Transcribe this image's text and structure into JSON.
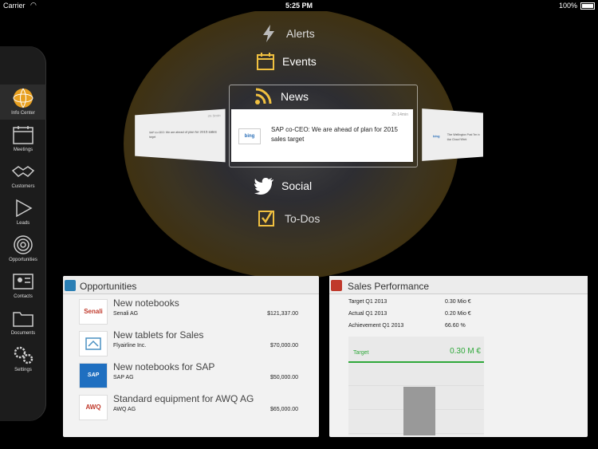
{
  "status_bar": {
    "carrier": "Carrier",
    "time": "5:25 PM",
    "battery": "100%"
  },
  "sidebar": {
    "items": [
      {
        "label": "Info Center",
        "icon": "globe-icon",
        "active": true
      },
      {
        "label": "Meetings",
        "icon": "calendar-icon"
      },
      {
        "label": "Customers",
        "icon": "handshake-icon"
      },
      {
        "label": "Leads",
        "icon": "arrow-icon"
      },
      {
        "label": "Opportunities",
        "icon": "target-icon"
      },
      {
        "label": "Contacts",
        "icon": "contacts-icon"
      },
      {
        "label": "Documents",
        "icon": "folder-icon"
      },
      {
        "label": "Settings",
        "icon": "gear-icon"
      }
    ]
  },
  "info_menu": {
    "alerts": "Alerts",
    "events": "Events",
    "news": "News",
    "social": "Social",
    "todos": "To-Dos"
  },
  "news": {
    "main": {
      "age": "2h 14min",
      "source": "bing",
      "title": "SAP co-CEO: We are ahead of plan for 2015 sales target"
    },
    "left": {
      "age": "2h 5min",
      "text": "SAP co-CEO: We are ahead of plan for 2015 sales target"
    },
    "right": {
      "source": "bing",
      "text": "The Wellington Post Ten in the Cloud Wars"
    }
  },
  "opportunities": {
    "title": "Opportunities",
    "rows": [
      {
        "title": "New notebooks",
        "company": "Senali AG",
        "amount": "$121,337.00",
        "logo": "Senali"
      },
      {
        "title": "New tablets for Sales",
        "company": "Flyairline Inc.",
        "amount": "$70,000.00",
        "logo": ""
      },
      {
        "title": "New notebooks for SAP",
        "company": "SAP AG",
        "amount": "$50,000.00",
        "logo": "SAP"
      },
      {
        "title": "Standard equipment for AWQ AG",
        "company": "AWQ AG",
        "amount": "$65,000.00",
        "logo": "AWQ"
      }
    ]
  },
  "sales_performance": {
    "title": "Sales Performance",
    "rows": [
      {
        "label": "Target Q1 2013",
        "value": "0.30 Mio €"
      },
      {
        "label": "Actual Q1 2013",
        "value": "0.20 Mio €"
      },
      {
        "label": "Achievement Q1 2013",
        "value": "66.60 %"
      }
    ],
    "chart": {
      "target_label": "Target",
      "target_value": "0.30 M €",
      "actual_fraction": 0.666
    }
  },
  "colors": {
    "accent_green": "#2fa83a",
    "opp_badge": "#2a7fb5",
    "perf_badge": "#c0392b",
    "icon_gold": "#f0c040"
  }
}
